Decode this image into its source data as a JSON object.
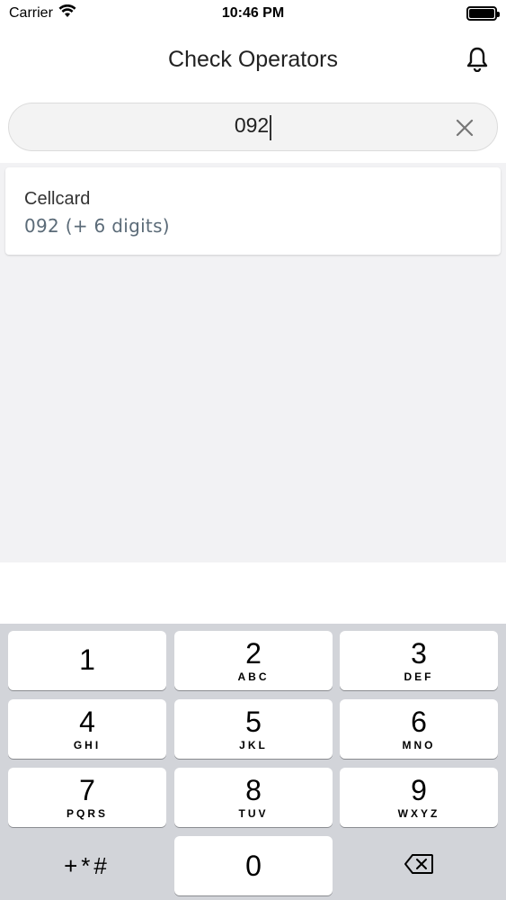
{
  "status_bar": {
    "carrier": "Carrier",
    "time": "10:46 PM"
  },
  "header": {
    "title": "Check Operators"
  },
  "search": {
    "value": "092"
  },
  "results": [
    {
      "name": "Cellcard",
      "detail": "092 (+ 6 digits)"
    }
  ],
  "keyboard": {
    "rows": [
      [
        {
          "num": "1",
          "letters": ""
        },
        {
          "num": "2",
          "letters": "ABC"
        },
        {
          "num": "3",
          "letters": "DEF"
        }
      ],
      [
        {
          "num": "4",
          "letters": "GHI"
        },
        {
          "num": "5",
          "letters": "JKL"
        },
        {
          "num": "6",
          "letters": "MNO"
        }
      ],
      [
        {
          "num": "7",
          "letters": "PQRS"
        },
        {
          "num": "8",
          "letters": "TUV"
        },
        {
          "num": "9",
          "letters": "WXYZ"
        }
      ]
    ],
    "symbols_label": "+*#",
    "zero": "0"
  },
  "icons": {
    "wifi": "wifi-icon",
    "battery": "battery-icon",
    "bell": "bell-icon",
    "clear": "close-icon",
    "backspace": "backspace-icon"
  }
}
